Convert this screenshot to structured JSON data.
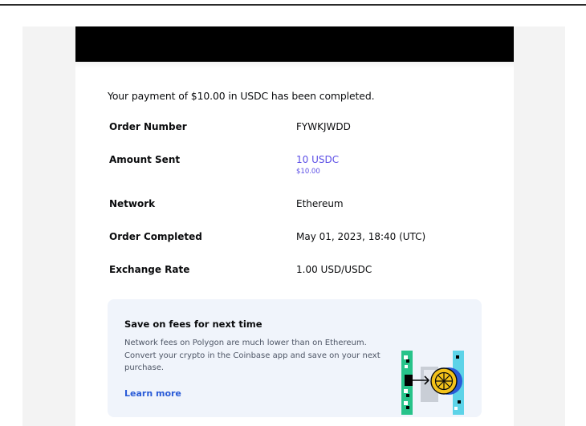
{
  "email": {
    "intro": "Your payment of $10.00 in USDC has been completed.",
    "rows": [
      {
        "label": "Order Number",
        "value": "FYWKJWDD"
      },
      {
        "label": "Amount Sent",
        "value": "10 USDC",
        "sub": "$10.00"
      },
      {
        "label": "Network",
        "value": "Ethereum"
      },
      {
        "label": "Order Completed",
        "value": "May 01, 2023, 18:40 (UTC)"
      },
      {
        "label": "Exchange Rate",
        "value": "1.00 USD/USDC"
      }
    ],
    "promo": {
      "title": "Save on fees for next time",
      "body": "Network fees on Polygon are much lower than on Ethereum. Convert your crypto in the Coinbase app and save on your next purchase.",
      "link": "Learn more",
      "art_icon": "network-transfer-illustration-icon"
    }
  },
  "colors": {
    "accent": "#5b4ee6",
    "link": "#2a5bd7",
    "promo_bg": "#f0f4fb",
    "banner": "#000000"
  }
}
